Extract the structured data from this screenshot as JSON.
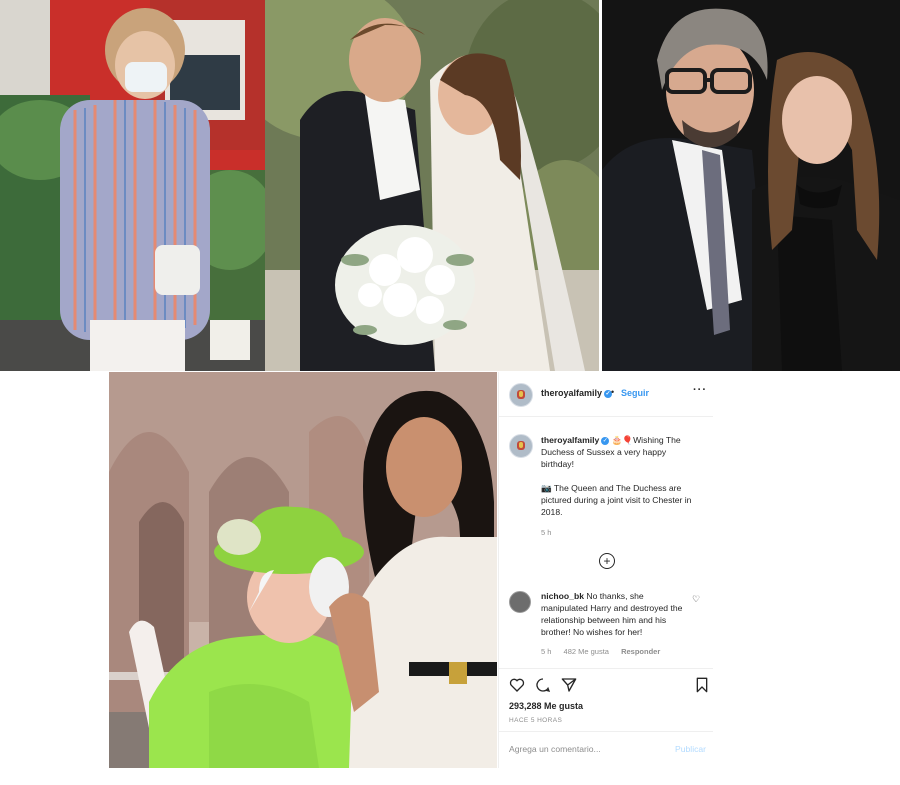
{
  "photos": [
    {
      "name": "woman-in-striped-shirt-photo"
    },
    {
      "name": "wedding-couple-photo"
    },
    {
      "name": "man-and-woman-black-background-photo"
    },
    {
      "name": "queen-and-duchess-photo"
    }
  ],
  "instagram": {
    "header": {
      "username": "theroyalfamily",
      "dot": "•",
      "follow_label": "Seguir",
      "more_label": "···"
    },
    "caption": {
      "username": "theroyalfamily",
      "line1": "🎂🎈Wishing The Duchess of Sussex a very happy birthday!",
      "line2": "📷 The Queen and The Duchess are pictured during a joint visit to Chester in 2018.",
      "time": "5 h"
    },
    "load_more_icon": "plus-circle-icon",
    "comment": {
      "username": "nichoo_bk",
      "text": "No thanks, she manipulated Harry and destroyed the relationship between him and his brother! No wishes for her!",
      "time": "5 h",
      "likes": "482 Me gusta",
      "reply_label": "Responder"
    },
    "actions": {
      "icons": [
        "heart-icon",
        "comment-icon",
        "share-icon",
        "bookmark-icon"
      ],
      "likes_count": "293,288 Me gusta",
      "posted_ago": "HACE 5 HORAS"
    },
    "add_comment": {
      "placeholder": "Agrega un comentario...",
      "post_label": "Publicar"
    }
  },
  "colors": {
    "link_blue": "#3897f0",
    "post_disabled": "#b3dbff",
    "muted_text": "#8e8e8e",
    "border": "#efefef"
  }
}
